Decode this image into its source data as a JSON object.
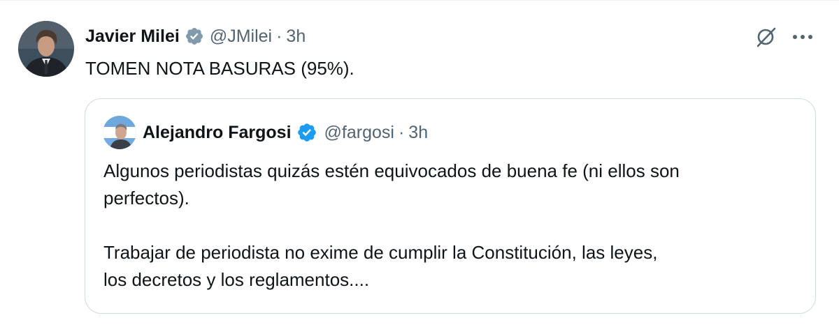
{
  "tweet": {
    "author_name": "Javier Milei",
    "author_handle": "@JMilei",
    "separator": "·",
    "time": "3h",
    "text": "TOMEN NOTA BASURAS (95%).",
    "verified_badge_color": "#829aab"
  },
  "quoted_tweet": {
    "author_name": "Alejandro Fargosi",
    "author_handle": "@fargosi",
    "separator": "·",
    "time": "3h",
    "paragraph_1_line_1": "Algunos periodistas quizás estén equivocados de buena fe (ni ellos son",
    "paragraph_1_line_2": "perfectos).",
    "paragraph_2_line_1": "Trabajar de periodista no exime de cumplir la Constitución, las leyes,",
    "paragraph_2_line_2": "los decretos y los reglamentos....",
    "verified_badge_color": "#1d9bf0"
  },
  "icons": {
    "grok": "grok-icon",
    "more": "more-icon",
    "verified": "verified-badge-icon"
  },
  "colors": {
    "text_primary": "#0f1419",
    "text_secondary": "#536471",
    "border": "#cfd9de"
  }
}
